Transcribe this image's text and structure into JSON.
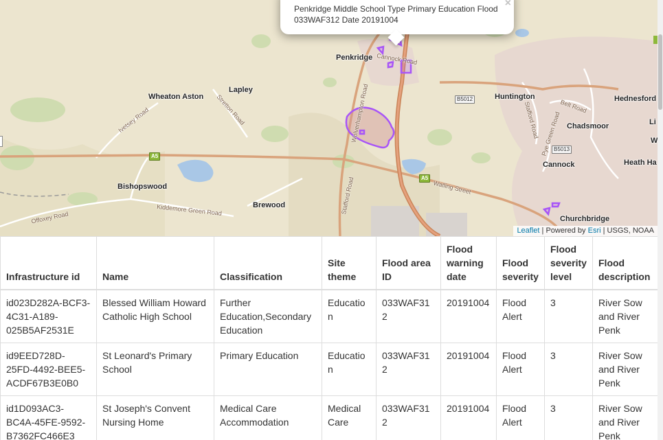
{
  "map": {
    "places": [
      {
        "id": "penkridge",
        "name": "Penkridge"
      },
      {
        "id": "wheaton-aston",
        "name": "Wheaton Aston"
      },
      {
        "id": "lapley",
        "name": "Lapley"
      },
      {
        "id": "huntington",
        "name": "Huntington"
      },
      {
        "id": "hednesford",
        "name": "Hednesford"
      },
      {
        "id": "chadsmoor",
        "name": "Chadsmoor"
      },
      {
        "id": "cannock",
        "name": "Cannock"
      },
      {
        "id": "heath-hayes",
        "name": "Heath Ha"
      },
      {
        "id": "bishopswood",
        "name": "Bishopswood"
      },
      {
        "id": "brewood",
        "name": "Brewood"
      },
      {
        "id": "churchbridge",
        "name": "Churchbridge"
      },
      {
        "id": "li",
        "name": "Li"
      },
      {
        "id": "w",
        "name": "W"
      }
    ],
    "roads": [
      {
        "id": "ivetsey-road",
        "name": "Ivetsey Road"
      },
      {
        "id": "stretton-road",
        "name": "Stretton Road"
      },
      {
        "id": "wolverhampton-road",
        "name": "Wolverhampton Road"
      },
      {
        "id": "cannock-road",
        "name": "Cannock Road"
      },
      {
        "id": "stafford-road-1",
        "name": "Stafford Road"
      },
      {
        "id": "stafford-road-2",
        "name": "Stafford Road"
      },
      {
        "id": "belt-road",
        "name": "Belt Road"
      },
      {
        "id": "pye-green-road",
        "name": "Pye Green Road"
      },
      {
        "id": "watling-street",
        "name": "Watling Street"
      },
      {
        "id": "kiddemore-green-road",
        "name": "Kiddemore Green Road"
      },
      {
        "id": "offoxey-road",
        "name": "Offoxey Road"
      }
    ],
    "shields": [
      {
        "id": "a5-west",
        "label": "A5",
        "style": "green"
      },
      {
        "id": "a5-east",
        "label": "A5",
        "style": "green"
      },
      {
        "id": "b5012",
        "label": "B5012",
        "style": "white"
      },
      {
        "id": "b5013",
        "label": "B5013",
        "style": "white"
      }
    ],
    "flood_area_color": "#a855f7",
    "popup": {
      "text": "Penkridge Middle School Type Primary Education Flood 033WAF312 Date 20191004",
      "close": "×"
    },
    "attribution": {
      "leaflet": "Leaflet",
      "powered": "| Powered by",
      "esri": "Esri",
      "sources": "| USGS, NOAA"
    }
  },
  "table": {
    "headers": [
      "Infrastructure id",
      "Name",
      "Classification",
      "Site theme",
      "Flood area ID",
      "Flood warning date",
      "Flood severity",
      "Flood severity level",
      "Flood description"
    ],
    "rows": [
      [
        "id023D282A-BCF3-4C31-A189-025B5AF2531E",
        "Blessed William Howard Catholic High School",
        "Further Education,Secondary Education",
        "Education",
        "033WAF312",
        "20191004",
        "Flood Alert",
        "3",
        "River Sow and River Penk"
      ],
      [
        "id9EED728D-25FD-4492-BEE5-ACDF67B3E0B0",
        "St Leonard's Primary School",
        "Primary Education",
        "Education",
        "033WAF312",
        "20191004",
        "Flood Alert",
        "3",
        "River Sow and River Penk"
      ],
      [
        "id1D093AC3-BC4A-45FE-9592-B7362FC466E3",
        "St Joseph's Convent Nursing Home",
        "Medical Care Accommodation",
        "Medical Care",
        "033WAF312",
        "20191004",
        "Flood Alert",
        "3",
        "River Sow and River Penk"
      ]
    ]
  }
}
